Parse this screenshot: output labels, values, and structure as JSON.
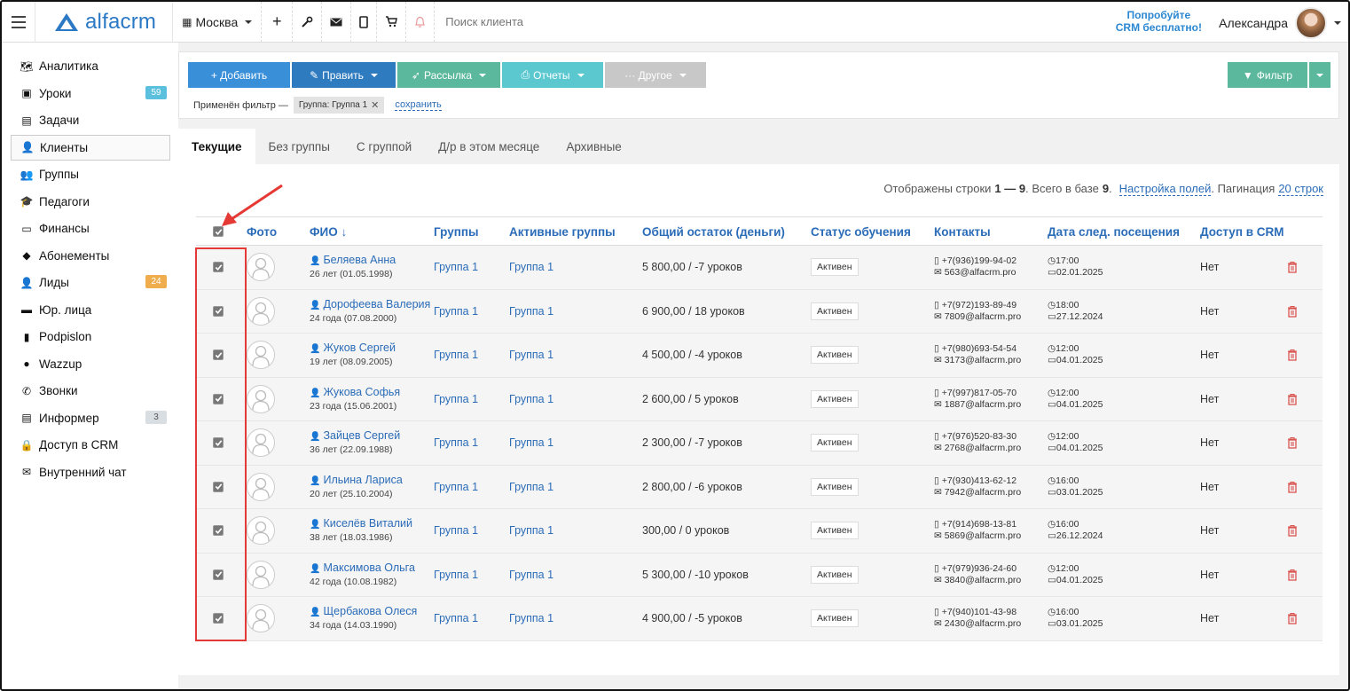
{
  "topbar": {
    "logo_text": "alfacrm",
    "city": "Москва",
    "search_placeholder": "Поиск клиента",
    "try_line1": "Попробуйте",
    "try_line2": "CRM бесплатно!",
    "user_name": "Александра",
    "icons": [
      "plus-icon",
      "wrench-icon",
      "envelope-icon",
      "phone-icon",
      "cart-icon",
      "bell-icon"
    ]
  },
  "sidebar": {
    "items": [
      {
        "label": "Аналитика",
        "icon": "map-icon"
      },
      {
        "label": "Уроки",
        "icon": "calendar-icon",
        "badge": "59",
        "badge_color": "#5bc0de"
      },
      {
        "label": "Задачи",
        "icon": "clipboard-icon"
      },
      {
        "label": "Клиенты",
        "icon": "user-icon",
        "active": true
      },
      {
        "label": "Группы",
        "icon": "users-icon"
      },
      {
        "label": "Педагоги",
        "icon": "graduation-cap-icon"
      },
      {
        "label": "Финансы",
        "icon": "money-icon"
      },
      {
        "label": "Абонементы",
        "icon": "tag-icon"
      },
      {
        "label": "Лиды",
        "icon": "user-plus-icon",
        "badge": "24",
        "badge_color": "#f0ad4e"
      },
      {
        "label": "Юр. лица",
        "icon": "briefcase-icon"
      },
      {
        "label": "Podpislon",
        "icon": "file-icon"
      },
      {
        "label": "Wazzup",
        "icon": "whatsapp-icon"
      },
      {
        "label": "Звонки",
        "icon": "phone-icon"
      },
      {
        "label": "Информер",
        "icon": "list-icon",
        "badge": "3",
        "badge_color": "#d9dee3"
      },
      {
        "label": "Доступ в CRM",
        "icon": "lock-icon"
      },
      {
        "label": "Внутренний чат",
        "icon": "envelope-icon"
      }
    ]
  },
  "toolbar": {
    "add": "+ Добавить",
    "edit": "Править",
    "mailing": "Рассылка",
    "reports": "Отчеты",
    "other": "··· Другое",
    "filter": "Фильтр",
    "colors": {
      "add": "#3a8fd9",
      "edit": "#2e7bbf",
      "mailing": "#5cb89c",
      "reports": "#5bc8d0",
      "other": "#c8c8c8",
      "filter": "#5cb89c"
    },
    "filter_applied": "Применён фильтр —",
    "chip": "Группа: Группа 1",
    "save": "сохранить"
  },
  "tabs": [
    "Текущие",
    "Без группы",
    "С группой",
    "Д/р в этом месяце",
    "Архивные"
  ],
  "stats": {
    "prefix": "Отображены строки",
    "range": "1 — 9",
    "total_prefix": ". Всего в базе",
    "total": "9",
    "suffix": ".",
    "fields_link": "Настройка полей",
    "pagination_label": ". Пагинация",
    "pagination_value": "20 строк"
  },
  "table": {
    "headers": {
      "photo": "Фото",
      "fio": "ФИО ↓",
      "groups": "Группы",
      "active_groups": "Активные группы",
      "balance": "Общий остаток (деньги)",
      "status": "Статус обучения",
      "contacts": "Контакты",
      "next_visit": "Дата след. посещения",
      "crm_access": "Доступ в CRM"
    },
    "rows": [
      {
        "name": "Беляева Анна",
        "age": "26 лет (01.05.1998)",
        "group": "Группа 1",
        "active_group": "Группа 1",
        "balance": "5 800,00 / -7 уроков",
        "status": "Активен",
        "phone": "+7(936)199-94-02",
        "email": "563@alfacrm.pro",
        "time": "17:00",
        "date": "02.01.2025",
        "access": "Нет"
      },
      {
        "name": "Дорофеева Валерия",
        "age": "24 года (07.08.2000)",
        "group": "Группа 1",
        "active_group": "Группа 1",
        "balance": "6 900,00 / 18 уроков",
        "status": "Активен",
        "phone": "+7(972)193-89-49",
        "email": "7809@alfacrm.pro",
        "time": "18:00",
        "date": "27.12.2024",
        "access": "Нет"
      },
      {
        "name": "Жуков Сергей",
        "age": "19 лет (08.09.2005)",
        "group": "Группа 1",
        "active_group": "Группа 1",
        "balance": "4 500,00 / -4 уроков",
        "status": "Активен",
        "phone": "+7(980)693-54-54",
        "email": "3173@alfacrm.pro",
        "time": "12:00",
        "date": "04.01.2025",
        "access": "Нет"
      },
      {
        "name": "Жукова Софья",
        "age": "23 года (15.06.2001)",
        "group": "Группа 1",
        "active_group": "Группа 1",
        "balance": "2 600,00 / 5 уроков",
        "status": "Активен",
        "phone": "+7(997)817-05-70",
        "email": "1887@alfacrm.pro",
        "time": "12:00",
        "date": "04.01.2025",
        "access": "Нет"
      },
      {
        "name": "Зайцев Сергей",
        "age": "36 лет (22.09.1988)",
        "group": "Группа 1",
        "active_group": "Группа 1",
        "balance": "2 300,00 / -7 уроков",
        "status": "Активен",
        "phone": "+7(976)520-83-30",
        "email": "2768@alfacrm.pro",
        "time": "12:00",
        "date": "04.01.2025",
        "access": "Нет"
      },
      {
        "name": "Ильина Лариса",
        "age": "20 лет (25.10.2004)",
        "group": "Группа 1",
        "active_group": "Группа 1",
        "balance": "2 800,00 / -6 уроков",
        "status": "Активен",
        "phone": "+7(930)413-62-12",
        "email": "7942@alfacrm.pro",
        "time": "16:00",
        "date": "03.01.2025",
        "access": "Нет"
      },
      {
        "name": "Киселёв Виталий",
        "age": "38 лет (18.03.1986)",
        "group": "Группа 1",
        "active_group": "Группа 1",
        "balance": "300,00 / 0 уроков",
        "status": "Активен",
        "phone": "+7(914)698-13-81",
        "email": "5869@alfacrm.pro",
        "time": "16:00",
        "date": "26.12.2024",
        "access": "Нет"
      },
      {
        "name": "Максимова Ольга",
        "age": "42 года (10.08.1982)",
        "group": "Группа 1",
        "active_group": "Группа 1",
        "balance": "5 300,00 / -10 уроков",
        "status": "Активен",
        "phone": "+7(979)936-24-60",
        "email": "3840@alfacrm.pro",
        "time": "12:00",
        "date": "04.01.2025",
        "access": "Нет"
      },
      {
        "name": "Щербакова Олеся",
        "age": "34 года (14.03.1990)",
        "group": "Группа 1",
        "active_group": "Группа 1",
        "balance": "4 900,00 / -5 уроков",
        "status": "Активен",
        "phone": "+7(940)101-43-98",
        "email": "2430@alfacrm.pro",
        "time": "16:00",
        "date": "03.01.2025",
        "access": "Нет"
      }
    ]
  },
  "annotation": {
    "highlight_color": "#e53935"
  }
}
